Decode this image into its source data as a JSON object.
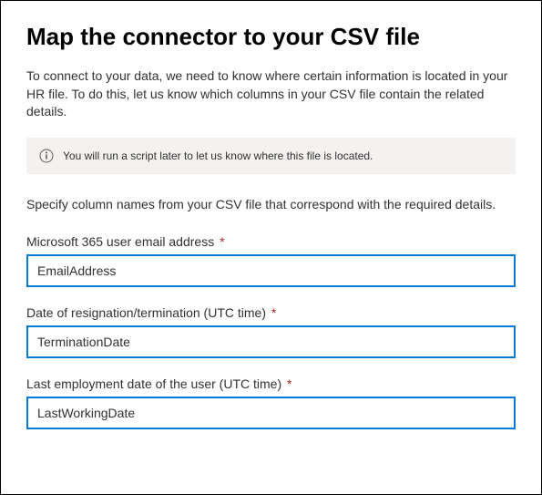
{
  "title": "Map the connector to your CSV file",
  "intro": "To connect to your data, we need to know where certain information is located in your HR file. To do this, let us know which columns in your CSV file contain the related details.",
  "banner": {
    "text": "You will run a script later to let us know where this file is located."
  },
  "instructions": "Specify column names from your CSV file that correspond with the required details.",
  "fields": {
    "email": {
      "label": "Microsoft 365 user email address",
      "required": "*",
      "value": "EmailAddress"
    },
    "termination": {
      "label": "Date of resignation/termination (UTC time)",
      "required": "*",
      "value": "TerminationDate"
    },
    "lastworking": {
      "label": "Last employment date of the user (UTC time)",
      "required": "*",
      "value": "LastWorkingDate"
    }
  }
}
